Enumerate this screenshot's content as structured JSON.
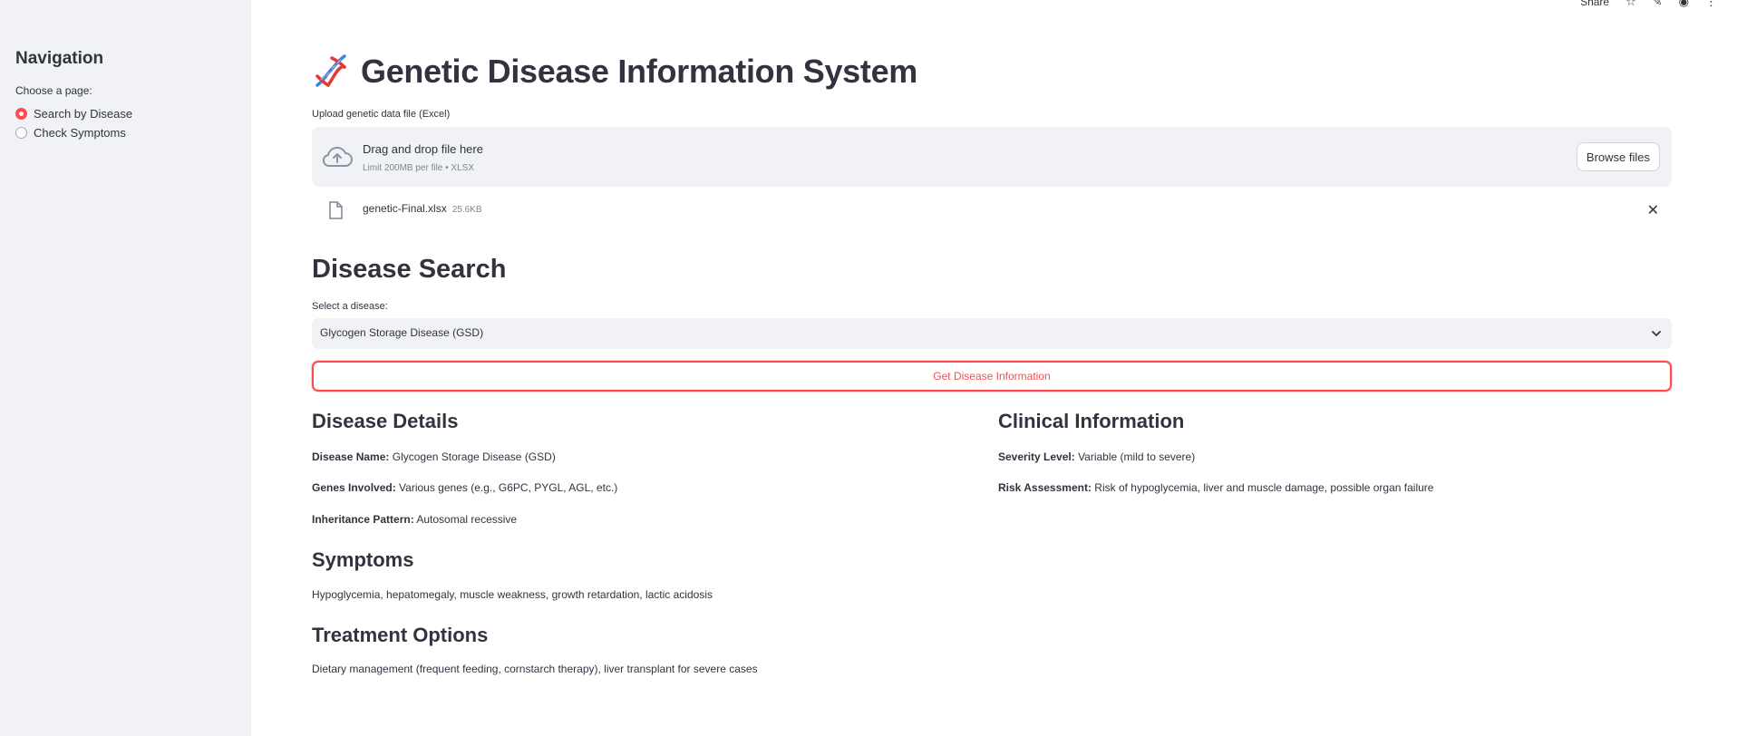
{
  "sidebar": {
    "title": "Navigation",
    "caption": "Choose a page:",
    "options": [
      {
        "label": "Search by Disease",
        "selected": true
      },
      {
        "label": "Check Symptoms",
        "selected": false
      }
    ]
  },
  "toolbar": {
    "share_label": "Share"
  },
  "header": {
    "icon": "dna-icon",
    "title": "Genetic Disease Information System"
  },
  "upload": {
    "label": "Upload genetic data file (Excel)",
    "drop_text": "Drag and drop file here",
    "limit_text": "Limit 200MB per file • XLSX",
    "browse_label": "Browse files",
    "file": {
      "name": "genetic-Final.xlsx",
      "size": "25.6KB"
    }
  },
  "search": {
    "heading": "Disease Search",
    "select_label": "Select a disease:",
    "selected_value": "Glycogen Storage Disease (GSD)",
    "button_label": "Get Disease Information"
  },
  "details": {
    "heading": "Disease Details",
    "name_key": "Disease Name:",
    "name_value": "Glycogen Storage Disease (GSD)",
    "genes_key": "Genes Involved:",
    "genes_value": "Various genes (e.g., G6PC, PYGL, AGL, etc.)",
    "inheritance_key": "Inheritance Pattern:",
    "inheritance_value": "Autosomal recessive"
  },
  "clinical": {
    "heading": "Clinical Information",
    "severity_key": "Severity Level:",
    "severity_value": "Variable (mild to severe)",
    "risk_key": "Risk Assessment:",
    "risk_value": "Risk of hypoglycemia, liver and muscle damage, possible organ failure"
  },
  "symptoms": {
    "heading": "Symptoms",
    "text": "Hypoglycemia, hepatomegaly, muscle weakness, growth retardation, lactic acidosis"
  },
  "treatment": {
    "heading": "Treatment Options",
    "text": "Dietary management (frequent feeding, cornstarch therapy), liver transplant for severe cases"
  },
  "colors": {
    "accent": "#ff4b4b",
    "sidebar_bg": "#f0f2f6",
    "text": "#31333f"
  }
}
